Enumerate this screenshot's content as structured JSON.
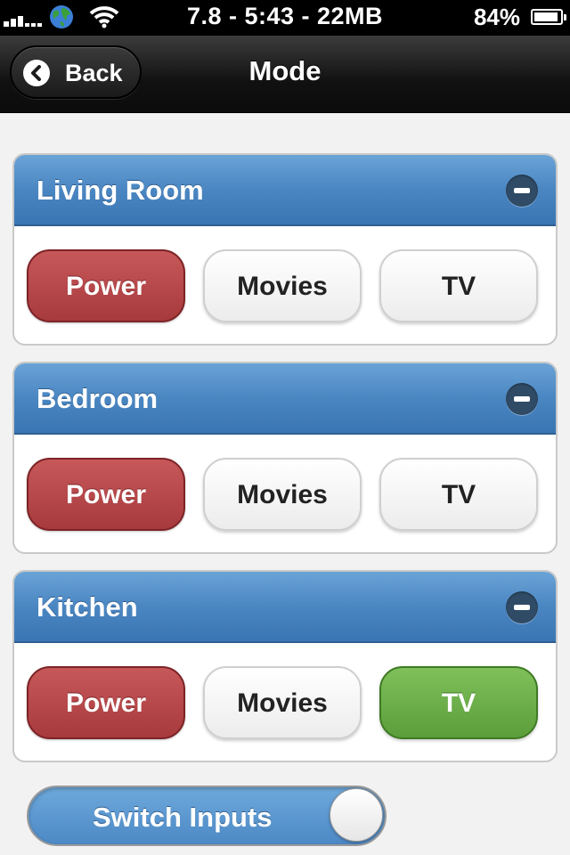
{
  "status_bar": {
    "center_text": "7.8 - 5:43 - 22MB",
    "battery_text": "84%",
    "icons": [
      "signal-icon",
      "globe-icon",
      "wifi-icon",
      "battery-icon"
    ]
  },
  "nav": {
    "back_label": "Back",
    "title": "Mode"
  },
  "sections": [
    {
      "title": "Living Room",
      "buttons": {
        "power": "Power",
        "movies": "Movies",
        "tv": "TV"
      },
      "active": "power"
    },
    {
      "title": "Bedroom",
      "buttons": {
        "power": "Power",
        "movies": "Movies",
        "tv": "TV"
      },
      "active": "power"
    },
    {
      "title": "Kitchen",
      "buttons": {
        "power": "Power",
        "movies": "Movies",
        "tv": "TV"
      },
      "active": "tv"
    }
  ],
  "switch": {
    "label": "Switch Inputs",
    "state": "on"
  },
  "colors": {
    "header_blue": "#4a86c2",
    "power_red": "#b4474a",
    "active_green": "#6aaf48",
    "navbar_black": "#111111"
  }
}
